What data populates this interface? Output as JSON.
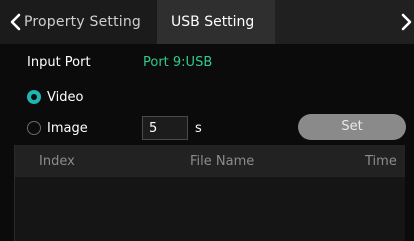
{
  "tabs": {
    "previous_label": "Property Setting",
    "active_label": "USB Setting",
    "icons": [
      "chevron-left-icon",
      "chevron-right-icon"
    ]
  },
  "input_port": {
    "label": "Input Port",
    "value": "Port 9:USB",
    "value_color": "#33c98a"
  },
  "mode": {
    "options": [
      "Video",
      "Image"
    ],
    "selected": "Video",
    "accent_color": "#1fb5b0"
  },
  "image_interval": {
    "value": "5",
    "unit": "s"
  },
  "set_button": {
    "label": "Set"
  },
  "file_table": {
    "columns": [
      "Index",
      "File Name",
      "Time"
    ],
    "rows": []
  }
}
